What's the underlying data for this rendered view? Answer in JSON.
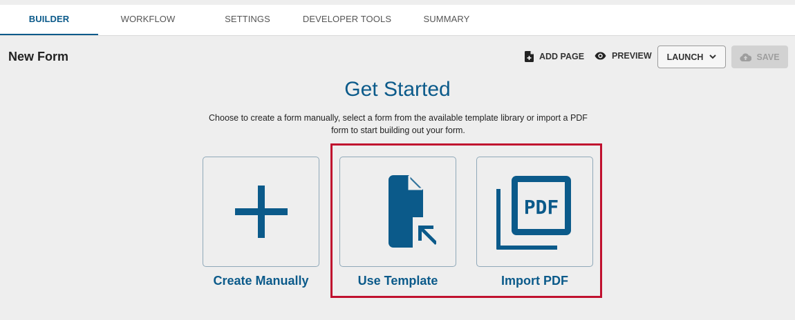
{
  "tabs": [
    {
      "label": "BUILDER",
      "active": true
    },
    {
      "label": "WORKFLOW",
      "active": false
    },
    {
      "label": "SETTINGS",
      "active": false
    },
    {
      "label": "DEVELOPER TOOLS",
      "active": false
    },
    {
      "label": "SUMMARY",
      "active": false
    }
  ],
  "header": {
    "title": "New Form",
    "add_page_label": "ADD PAGE",
    "add_page_icon": "file-plus-icon",
    "preview_label": "PREVIEW",
    "preview_icon": "eye-icon",
    "launch_label": "LAUNCH",
    "save_label": "SAVE",
    "save_icon": "cloud-upload-icon",
    "save_disabled": true
  },
  "main": {
    "heading": "Get Started",
    "description": "Choose to create a form manually, select a form from the available template library or import a PDF form to start building out your form.",
    "options": [
      {
        "label": "Create Manually",
        "icon": "plus-icon"
      },
      {
        "label": "Use Template",
        "icon": "document-pointer-icon"
      },
      {
        "label": "Import PDF",
        "icon": "pdf-stack-icon"
      }
    ]
  },
  "colors": {
    "accent": "#0b5a8a",
    "highlight": "#c0102e",
    "background": "#eeeeee"
  }
}
